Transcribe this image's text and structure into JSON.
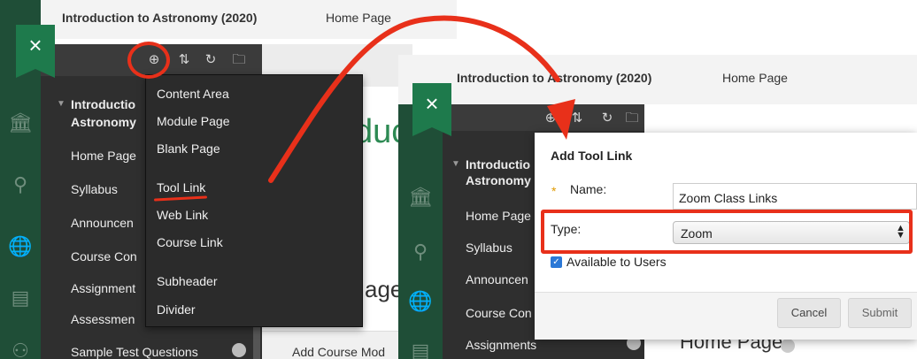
{
  "colors": {
    "rail_green": "#1f4e37",
    "close_green": "#1e7a4c",
    "panel_dark": "#2f2f2f",
    "annotation_red": "#e8301a",
    "heading_green": "#2d8a53",
    "checkbox_blue": "#2b78d6"
  },
  "left": {
    "course_title": "Introduction to Astronomy (2020)",
    "home_title": "Home Page",
    "close_icon": "×",
    "toolbar_icons": [
      "⊕",
      "⇅",
      "↻",
      "🗀"
    ],
    "course_name_line1": "Introductio",
    "course_name_line2": "Astronomy",
    "nav_items": [
      "Home Page",
      "Syllabus",
      "Announcen",
      "Course Con",
      "Assignment",
      "Assessmen",
      "Sample Test Questions"
    ],
    "menu_items": [
      "Content Area",
      "Module Page",
      "Blank Page",
      "Tool Link",
      "Web Link",
      "Course Link",
      "Subheader",
      "Divider"
    ],
    "heading_fragment": "duc",
    "page_fragment": "age",
    "add_course_module": "Add Course Mod",
    "rail_icons": [
      "🏛",
      "⚲",
      "🌐",
      "▤",
      "⚇"
    ]
  },
  "right": {
    "course_title": "Introduction to Astronomy (2020)",
    "home_title": "Home Page",
    "close_icon": "×",
    "toolbar_icons": [
      "⊕",
      "⇅",
      "↻",
      "🗀"
    ],
    "course_name_line1": "Introductio",
    "course_name_line2": "Astronomy",
    "nav_items": [
      "Home Page",
      "Syllabus",
      "Announcen",
      "Course Con",
      "Assignments"
    ],
    "home_page_heading": "Home Page",
    "rail_icons": [
      "🏛",
      "⚲",
      "🌐",
      "▤"
    ],
    "dialog": {
      "title": "Add Tool Link",
      "required_star": "*",
      "name_label": "Name:",
      "name_value": "Zoom Class Links",
      "type_label": "Type:",
      "type_value": "Zoom",
      "select_arrows": "▲▼",
      "available_label": "Available to Users",
      "available_checked": true,
      "cancel_label": "Cancel",
      "submit_label": "Submit"
    }
  }
}
